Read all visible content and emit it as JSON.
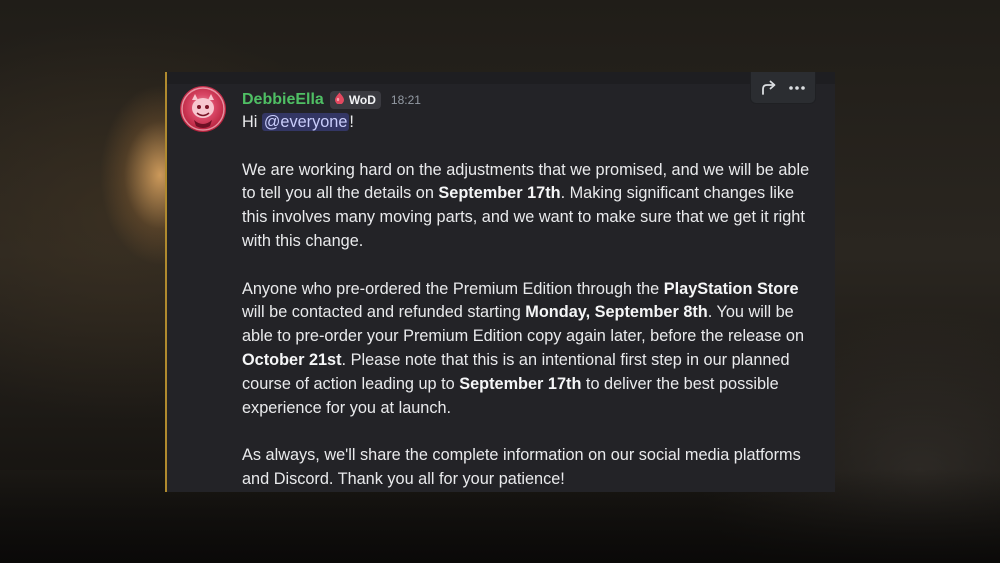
{
  "message": {
    "author": "DebbieElla",
    "tag": "WoD",
    "timestamp": "18:21",
    "greeting": "Hi ",
    "mention": "@everyone",
    "greeting_end": "!",
    "p1": {
      "t1": "We are working hard on the adjustments that we promised, and we will be able to tell you all the details on ",
      "b1": "September 17th",
      "t2": ". Making significant changes like this involves many moving parts, and we want to make sure that we get it right with this change."
    },
    "p2": {
      "t1": "Anyone who pre-ordered the Premium Edition through the ",
      "b1": "PlayStation Store",
      "t2": " will be contacted and refunded starting ",
      "b2": "Monday, September 8th",
      "t3": ". You will be able to pre-order your Premium Edition copy again later, before the release on ",
      "b3": "October 21st",
      "t4": ". Please note that this is an intentional first step in our planned course of action leading up to ",
      "b4": "September 17th",
      "t5": " to deliver the best possible experience for you at launch."
    },
    "p3": "As always, we'll share the complete information on our social media platforms and Discord. Thank you all for your patience!"
  },
  "icons": {
    "forward": "forward-arrow-icon",
    "more": "more-options-icon",
    "tag_icon": "blood-drop-icon",
    "avatar": "avatar-image"
  },
  "colors": {
    "username": "#4fbf64",
    "mention_bg": "#5865f2",
    "card_bg": "#232327",
    "accent_border": "#b08a2e"
  }
}
